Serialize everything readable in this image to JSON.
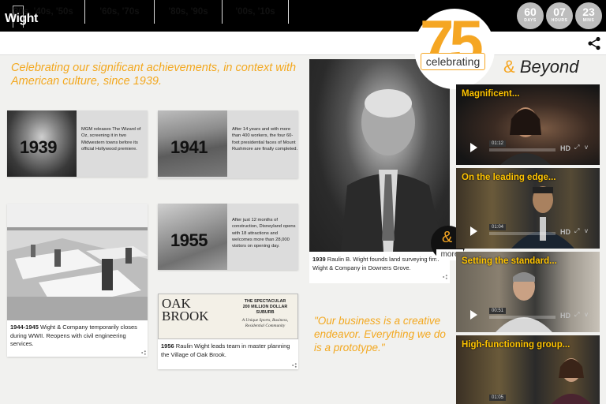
{
  "header": {
    "logo": "Wight",
    "countdown": [
      {
        "value": "60",
        "unit": "DAYS"
      },
      {
        "value": "07",
        "unit": "HOURS"
      },
      {
        "value": "23",
        "unit": "MINS"
      }
    ]
  },
  "nav": {
    "items": [
      "'30s, '40s, '50s",
      "'60s, '70s",
      "'80s, '90s",
      "'00s, '10s"
    ]
  },
  "intro": "Celebrating our significant achievements, in context with American culture, since 1939.",
  "badge": {
    "number": "75",
    "word": "celebrating",
    "amp": "&",
    "beyond": "Beyond"
  },
  "cards": {
    "y1939": {
      "year": "1939",
      "text": "MGM releases The Wizard of Oz, screening it in two Midwestern towns before its official Hollywood premiere."
    },
    "y1941": {
      "year": "1941",
      "text": "After 14 years and with more than 400 workers, the four 60-foot presidential faces of Mount Rushmore are finally completed."
    },
    "y1955": {
      "year": "1955",
      "text": "After just 12 months of construction, Disneyland opens with 18 attractions and welcomes more than 28,000 visitors on opening day."
    },
    "drafting": {
      "year": "1944-1945",
      "text": "Wight & Company temporarily closes during WWII. Reopens with civil engineering services."
    },
    "oakbrook": {
      "year": "1956",
      "text": "Raulin Wight leads team in master planning the Village of Oak Brook.",
      "sign_line1": "OAK",
      "sign_line2": "BROOK",
      "sign_right1": "THE SPECTACULAR",
      "sign_right2": "200 MILLION DOLLAR",
      "sign_right3": "SUBURB",
      "sign_sub": "A Unique Sports, Business, Residential Community"
    },
    "portrait": {
      "year": "1939",
      "text": "Raulin B. Wight founds land surveying firm Wight & Company in Downers Grove."
    }
  },
  "more": {
    "amp": "&",
    "label": "more"
  },
  "quote": "\"Our business is a creative endeavor. Everything we do is a prototype.\"",
  "videos": [
    {
      "title": "Magnificent...",
      "time": "01:12",
      "hd": "HD"
    },
    {
      "title": "On the leading edge...",
      "time": "01:04",
      "hd": "HD"
    },
    {
      "title": "Setting the standard...",
      "time": "00:51",
      "hd": "HD"
    },
    {
      "title": "High-functioning group...",
      "time": "01:05",
      "hd": "HD"
    }
  ],
  "colors": {
    "accent": "#f5a623",
    "intro_text": "#f3a81f",
    "video_title": "#ffc400",
    "topbar": "#000000"
  }
}
